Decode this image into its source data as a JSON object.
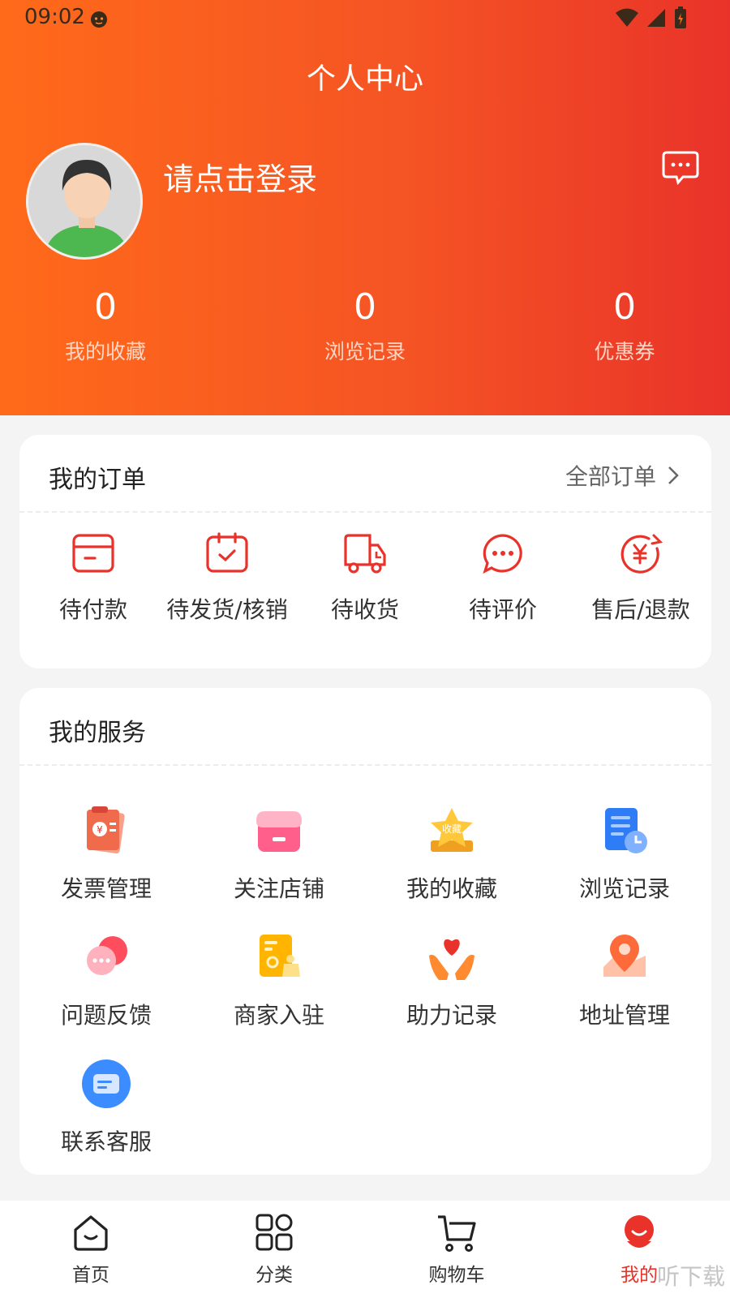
{
  "status_bar": {
    "time": "09:02"
  },
  "header": {
    "title": "个人中心",
    "login_prompt": "请点击登录"
  },
  "stats": [
    {
      "value": "0",
      "label": "我的收藏"
    },
    {
      "value": "0",
      "label": "浏览记录"
    },
    {
      "value": "0",
      "label": "优惠券"
    }
  ],
  "orders": {
    "title": "我的订单",
    "all_link": "全部订单",
    "items": [
      {
        "label": "待付款",
        "icon": "wallet-icon"
      },
      {
        "label": "待发货/核销",
        "icon": "box-check-icon"
      },
      {
        "label": "待收货",
        "icon": "truck-icon"
      },
      {
        "label": "待评价",
        "icon": "chat-bubble-icon"
      },
      {
        "label": "售后/退款",
        "icon": "yuan-refund-icon"
      }
    ]
  },
  "services": {
    "title": "我的服务",
    "items": [
      {
        "label": "发票管理",
        "icon": "invoice-icon"
      },
      {
        "label": "关注店铺",
        "icon": "store-icon"
      },
      {
        "label": "我的收藏",
        "icon": "favorite-star-icon",
        "badge": "收藏"
      },
      {
        "label": "浏览记录",
        "icon": "history-doc-icon"
      },
      {
        "label": "问题反馈",
        "icon": "feedback-bubble-icon"
      },
      {
        "label": "商家入驻",
        "icon": "merchant-doc-icon"
      },
      {
        "label": "助力记录",
        "icon": "heart-hands-icon"
      },
      {
        "label": "地址管理",
        "icon": "map-pin-icon"
      },
      {
        "label": "联系客服",
        "icon": "customer-service-icon"
      }
    ]
  },
  "tabbar": {
    "items": [
      {
        "label": "首页",
        "icon": "home-icon"
      },
      {
        "label": "分类",
        "icon": "category-grid-icon"
      },
      {
        "label": "购物车",
        "icon": "cart-icon"
      },
      {
        "label": "我的",
        "icon": "profile-icon"
      }
    ],
    "active": "我的"
  },
  "watermark": "听下载",
  "colors": {
    "accent": "#e8322a",
    "header_start": "#ff6a1a",
    "header_end": "#e9332a"
  }
}
